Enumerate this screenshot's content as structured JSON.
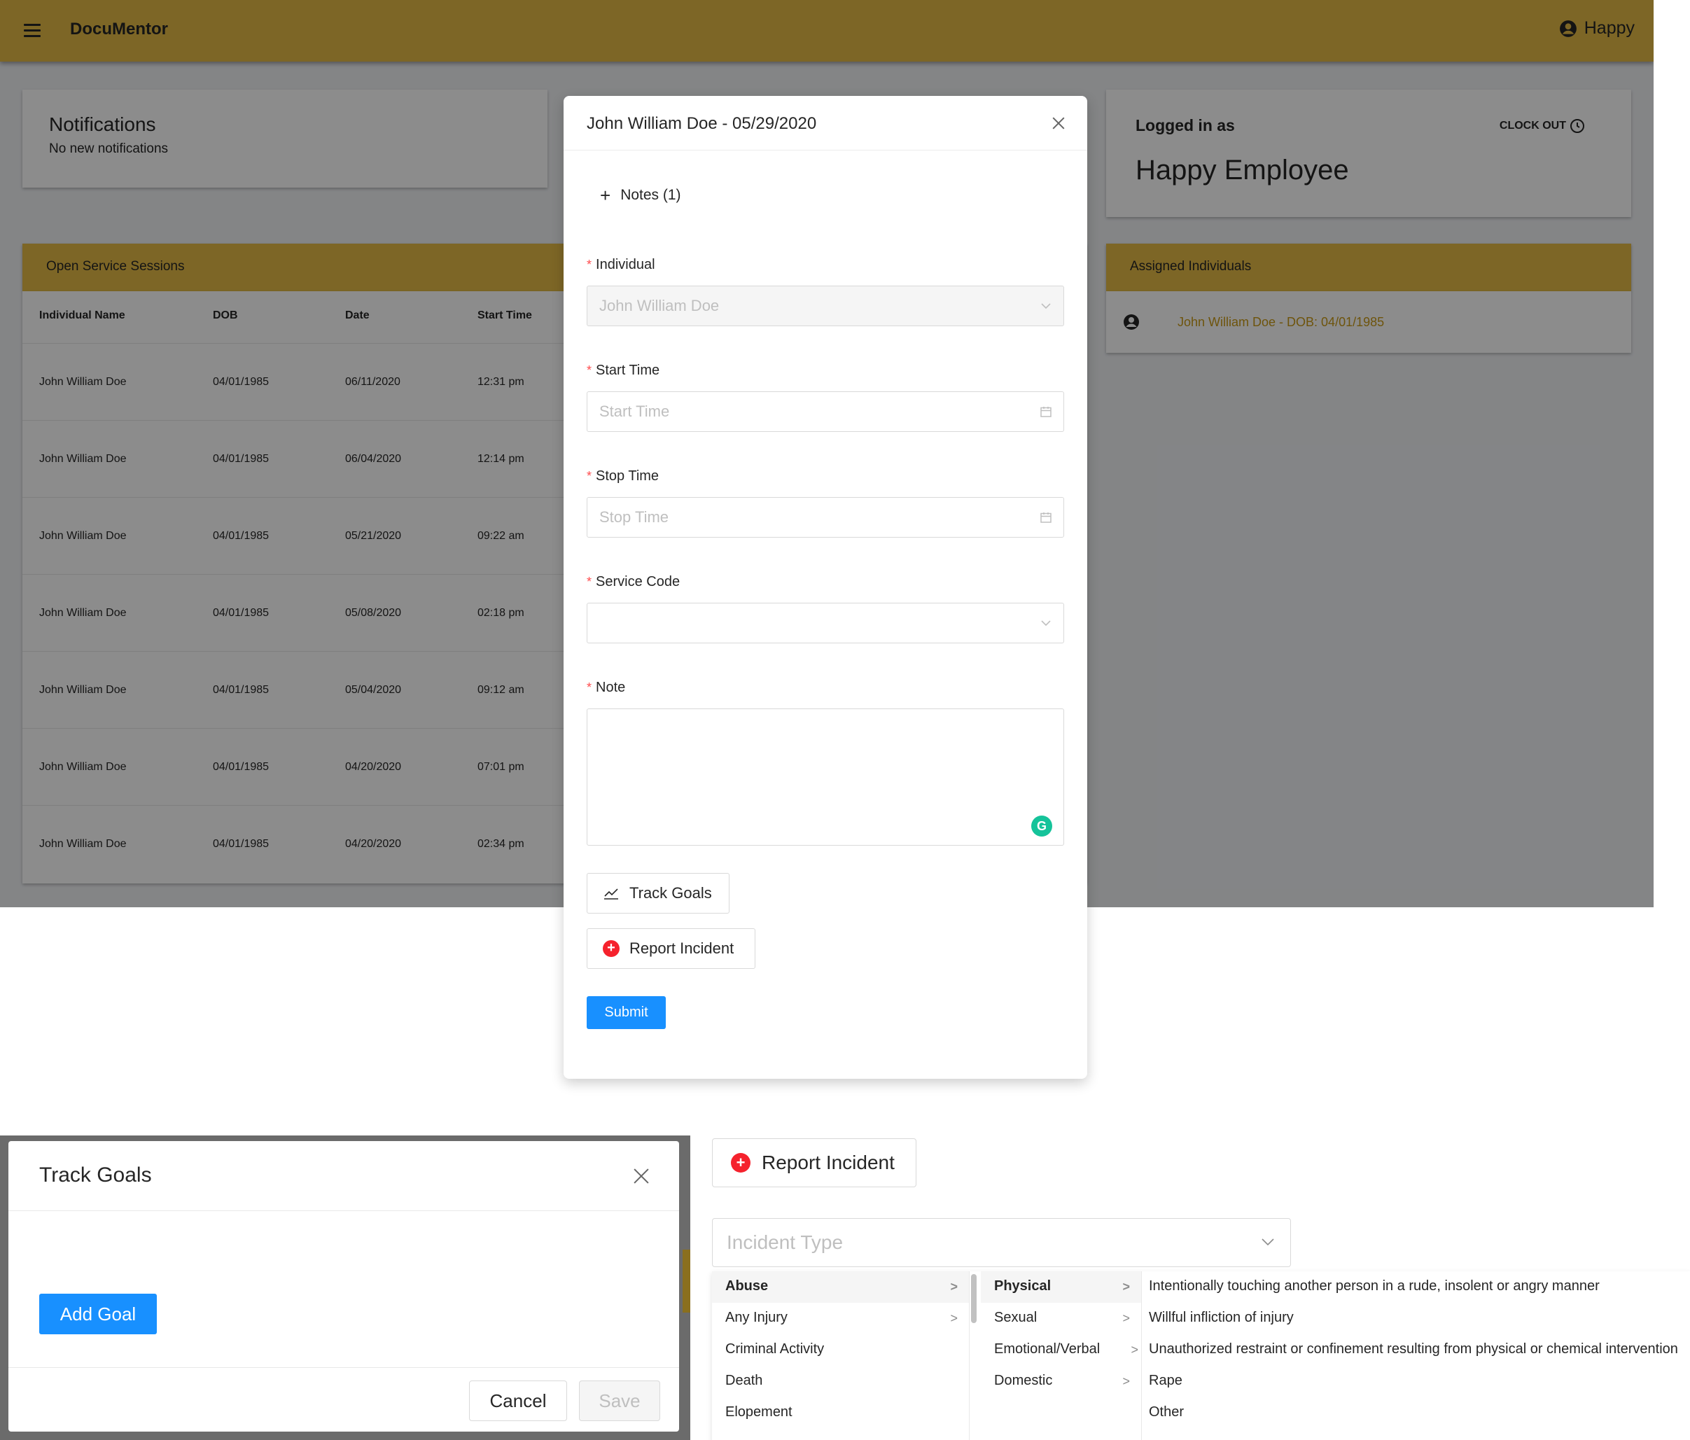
{
  "app": {
    "brand": "DocuMentor",
    "user_menu_label": "Happy"
  },
  "notifications": {
    "title": "Notifications",
    "message": "No new notifications"
  },
  "sessions": {
    "title": "Open Service Sessions",
    "columns": [
      "Individual Name",
      "DOB",
      "Date",
      "Start Time"
    ],
    "rows": [
      [
        "John William Doe",
        "04/01/1985",
        "06/11/2020",
        "12:31 pm"
      ],
      [
        "John William Doe",
        "04/01/1985",
        "06/04/2020",
        "12:14 pm"
      ],
      [
        "John William Doe",
        "04/01/1985",
        "05/21/2020",
        "09:22 am"
      ],
      [
        "John William Doe",
        "04/01/1985",
        "05/08/2020",
        "02:18 pm"
      ],
      [
        "John William Doe",
        "04/01/1985",
        "05/04/2020",
        "09:12 am"
      ],
      [
        "John William Doe",
        "04/01/1985",
        "04/20/2020",
        "07:01 pm"
      ],
      [
        "John William Doe",
        "04/01/1985",
        "04/20/2020",
        "02:34 pm"
      ]
    ]
  },
  "logged_in": {
    "label": "Logged in as",
    "name": "Happy Employee",
    "clock_out": "CLOCK OUT"
  },
  "assigned": {
    "title": "Assigned Individuals",
    "items": [
      "John William Doe - DOB: 04/01/1985"
    ]
  },
  "modal": {
    "title": "John William Doe - 05/29/2020",
    "notes_toggle": "Notes (1)",
    "required_mark": "*",
    "individual": {
      "label": "Individual",
      "value": "John William Doe"
    },
    "start_time": {
      "label": "Start Time",
      "placeholder": "Start Time"
    },
    "stop_time": {
      "label": "Stop Time",
      "placeholder": "Stop Time"
    },
    "service_code": {
      "label": "Service Code",
      "value": ""
    },
    "note": {
      "label": "Note",
      "value": ""
    },
    "track_goals_label": "Track Goals",
    "report_incident_label": "Report Incident",
    "submit_label": "Submit"
  },
  "track_goals": {
    "title": "Track Goals",
    "add_goal_label": "Add Goal",
    "cancel_label": "Cancel",
    "save_label": "Save"
  },
  "report_incident": {
    "button_label": "Report Incident",
    "select_placeholder": "Incident Type",
    "categories": [
      {
        "label": "Abuse",
        "has_children": true,
        "active": true
      },
      {
        "label": "Any Injury",
        "has_children": true
      },
      {
        "label": "Criminal Activity",
        "has_children": false
      },
      {
        "label": "Death",
        "has_children": false
      },
      {
        "label": "Elopement",
        "has_children": false
      }
    ],
    "subcategories": [
      {
        "label": "Physical",
        "active": true
      },
      {
        "label": "Sexual"
      },
      {
        "label": "Emotional/Verbal"
      },
      {
        "label": "Domestic"
      }
    ],
    "descriptions": [
      "Intentionally touching another person in a rude, insolent or angry manner",
      "Willful infliction of injury",
      "Unauthorized restraint or confinement resulting from physical or chemical intervention",
      "Rape",
      "Other"
    ]
  },
  "colors": {
    "header_yellow": "#e3bb45",
    "primary_blue": "#1890ff",
    "link_gold": "#c99a16",
    "required_red": "#ff4d4f"
  }
}
